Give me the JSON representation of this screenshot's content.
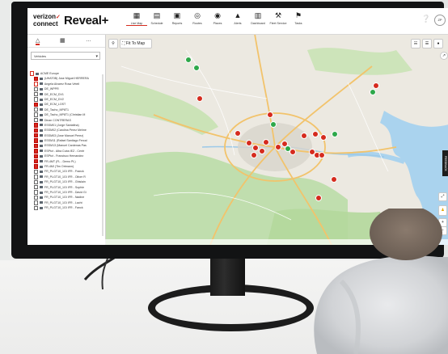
{
  "app": {
    "brand_top": "verizon",
    "brand_bottom": "connect",
    "product": "Reveal+"
  },
  "nav_items": [
    {
      "label": "Live Map",
      "icon": "map-icon",
      "active": true
    },
    {
      "label": "Schedule",
      "icon": "schedule-icon",
      "active": false
    },
    {
      "label": "Reports",
      "icon": "reports-icon",
      "active": false
    },
    {
      "label": "Routes",
      "icon": "routes-icon",
      "active": false
    },
    {
      "label": "Places",
      "icon": "places-icon",
      "active": false
    },
    {
      "label": "Alerts",
      "icon": "alerts-icon",
      "active": false
    },
    {
      "label": "Dashboard",
      "icon": "dashboard-icon",
      "active": false
    },
    {
      "label": "Fleet Service",
      "icon": "fleet-service-icon",
      "active": false
    },
    {
      "label": "Tasks",
      "icon": "tasks-icon",
      "active": false
    }
  ],
  "header_right": {
    "help_label": "Help",
    "user_label": "ZP"
  },
  "sidebar": {
    "select_value": "Vehicles",
    "tree": [
      {
        "label": "ACME Europe",
        "state": "dot",
        "indent": 0
      },
      {
        "label": "(UHAT0B) Jose Miguel HERRERA",
        "state": "on",
        "indent": 1
      },
      {
        "label": "Angela Alvarez Rosa Veteli",
        "state": "dot",
        "indent": 1
      },
      {
        "label": "DE_WPPR",
        "state": "off",
        "indent": 1
      },
      {
        "label": "DE_ECM_DV1",
        "state": "off",
        "indent": 1
      },
      {
        "label": "DE_ECM_DV2",
        "state": "off",
        "indent": 1
      },
      {
        "label": "DE_ECM_LOST",
        "state": "on",
        "indent": 1
      },
      {
        "label": "DE_Tacho_MP8T1",
        "state": "off",
        "indent": 1
      },
      {
        "label": "DE_Tacho_MP8T1 (Christian M",
        "state": "off",
        "indent": 1
      },
      {
        "label": "Dinan CONTRERAS",
        "state": "off",
        "indent": 1
      },
      {
        "label": "ESSM01 (Jorge Santafina)",
        "state": "on",
        "indent": 1
      },
      {
        "label": "ESSM02 (Carolina Perez Melme",
        "state": "on",
        "indent": 1
      },
      {
        "label": "ESSM03 (Jose Manuel Perez)",
        "state": "on",
        "indent": 1
      },
      {
        "label": "ESSM11 (Rafael Santiago Fercal",
        "state": "on",
        "indent": 1
      },
      {
        "label": "ESSM13 (Manuel Cardenas Pas",
        "state": "on",
        "indent": 1
      },
      {
        "label": "ESPtct - Alba Cuba IEZ - Centr",
        "state": "on",
        "indent": 1
      },
      {
        "label": "ESPtct - Francisco Hernandez",
        "state": "on",
        "indent": 1
      },
      {
        "label": "FR-4MT (FL - Demo PL)",
        "state": "on",
        "indent": 1
      },
      {
        "label": "FR-4MI (Tim Ortmann)",
        "state": "on",
        "indent": 1
      },
      {
        "label": "FR_PLGT10_1GI IFR - Franck",
        "state": "off",
        "indent": 1
      },
      {
        "label": "FR_PLGT10_1GI IFR - Oliver R",
        "state": "off",
        "indent": 1
      },
      {
        "label": "FR_PLGT10_1GI IFR - Ghislain",
        "state": "off",
        "indent": 1
      },
      {
        "label": "FR_PLGT10_1GI IFR - Sophie",
        "state": "off",
        "indent": 1
      },
      {
        "label": "FR_PLGT10_1GI IFR - David Gi",
        "state": "off",
        "indent": 1
      },
      {
        "label": "FR_PLGT10_1GI IFR - Nadine",
        "state": "off",
        "indent": 1
      },
      {
        "label": "FR_PLGT10_1GI IFR - Lacht",
        "state": "off",
        "indent": 1
      },
      {
        "label": "FR_PLGT10_1GI IFR - Fanck",
        "state": "off",
        "indent": 1
      }
    ]
  },
  "map": {
    "fit_to_map_label": "Fit To Map",
    "feedback_label": "FEEDBACK",
    "marker_colors": {
      "alert": "#d52b1e",
      "ok": "#2ea84a"
    }
  },
  "colors": {
    "accent": "#d52b1e",
    "ok": "#2ea84a",
    "water": "#a9d1ee",
    "greenbelt": "#b8dba3"
  }
}
